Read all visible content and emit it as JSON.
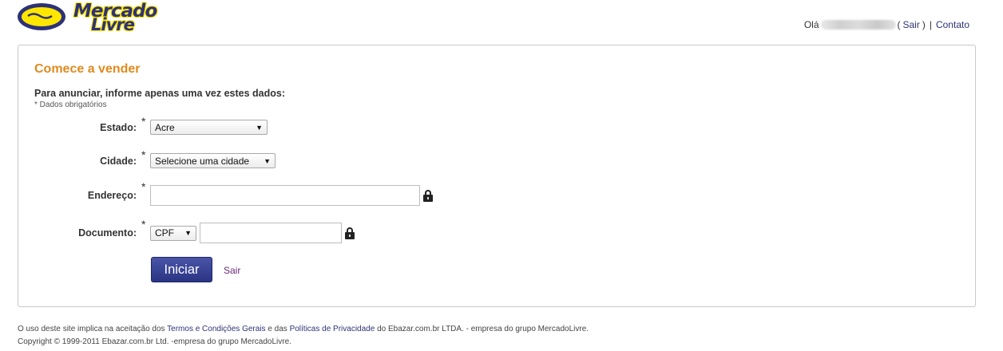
{
  "brand": {
    "logo_line1": "Mercado",
    "logo_line2": "Livre",
    "colors": {
      "primary": "#2d3277",
      "accent": "#ffe600",
      "title": "#e08a1e"
    }
  },
  "user_bar": {
    "greeting": "Olá",
    "logout_open": "(",
    "logout_label": "Sair",
    "logout_close": ")",
    "separator": "|",
    "contact_label": "Contato"
  },
  "form": {
    "title": "Comece a vender",
    "subtitle": "Para anunciar, informe apenas uma vez estes dados:",
    "required_note": "* Dados obrigatórios",
    "required_mark": "*",
    "estado": {
      "label": "Estado:",
      "value": "Acre"
    },
    "cidade": {
      "label": "Cidade:",
      "value": "Selecione uma cidade"
    },
    "endereco": {
      "label": "Endereço:",
      "value": ""
    },
    "documento": {
      "label": "Documento:",
      "type_value": "CPF",
      "value": ""
    },
    "submit_label": "Iniciar",
    "cancel_label": "Sair"
  },
  "footer": {
    "line1_prefix": "O uso deste site implica na aceitação dos ",
    "terms_link": "Termos e Condições Gerais",
    "line1_mid": " e das ",
    "privacy_link": "Políticas de Privacidade",
    "line1_suffix": " do Ebazar.com.br LTDA. - empresa do grupo MercadoLivre.",
    "copyright": "Copyright © 1999-2011 Ebazar.com.br Ltd. -empresa do grupo MercadoLivre."
  }
}
